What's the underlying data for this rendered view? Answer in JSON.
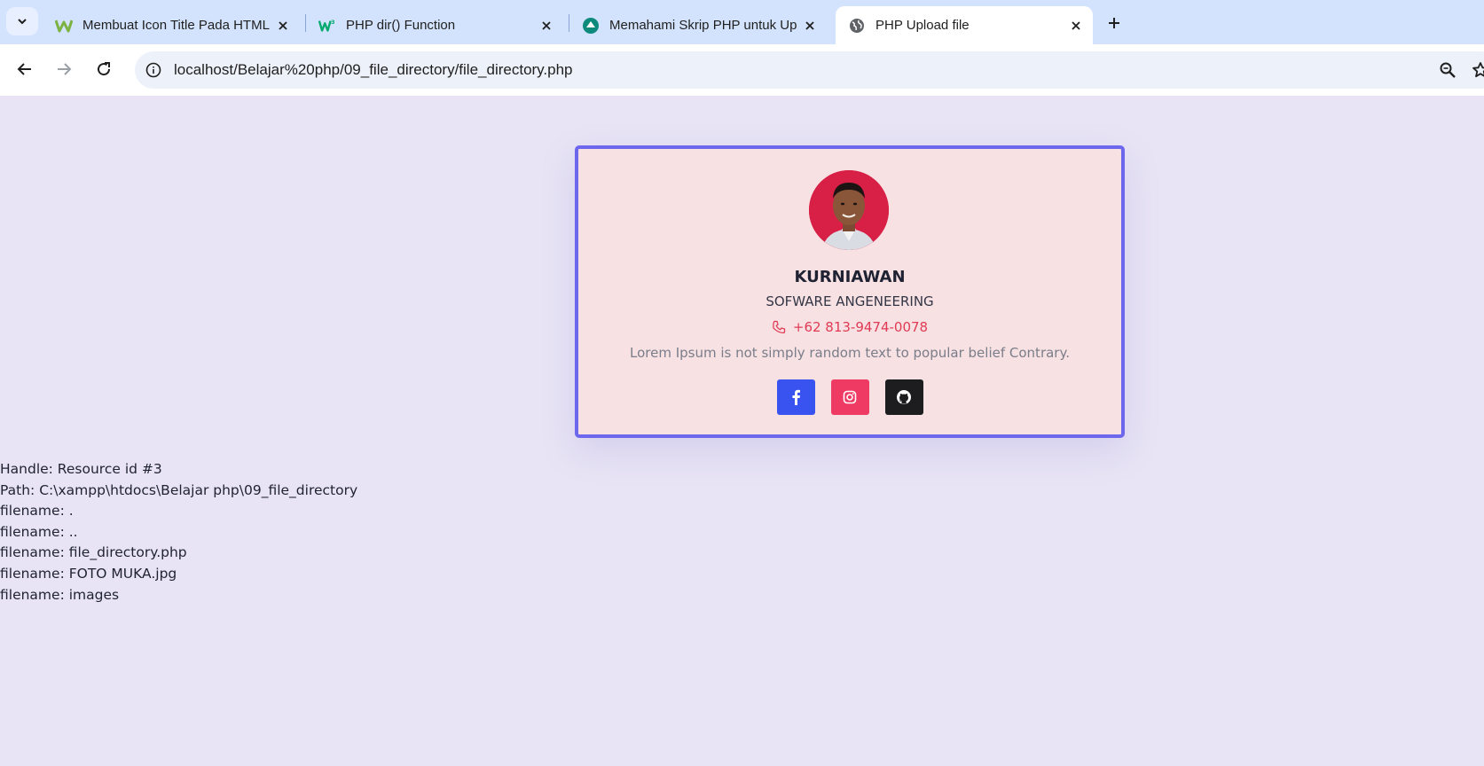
{
  "browser": {
    "tabs": [
      {
        "title": "Membuat Icon Title Pada HTML",
        "icon": "w-green-icon",
        "active": false
      },
      {
        "title": "PHP dir() Function",
        "icon": "w3schools-icon",
        "active": false
      },
      {
        "title": "Memahami Skrip PHP untuk Up",
        "icon": "teal-circle-icon",
        "active": false
      },
      {
        "title": "PHP Upload file",
        "icon": "globe-icon",
        "active": true
      }
    ],
    "url": "localhost/Belajar%20php/09_file_directory/file_directory.php"
  },
  "profile": {
    "name": "KURNIAWAN",
    "role": "SOFWARE ANGENEERING",
    "phone": "+62 813-9474-0078",
    "description": "Lorem Ipsum is not simply random text to popular belief Contrary."
  },
  "output": {
    "handle": "Handle: Resource id #3",
    "path": "Path: C:\\xampp\\htdocs\\Belajar php\\09_file_directory",
    "files": [
      "filename: .",
      "filename: ..",
      "filename: file_directory.php",
      "filename: FOTO MUKA.jpg",
      "filename: images"
    ]
  },
  "colors": {
    "accent_border": "#6d67ee",
    "phone": "#e03a54",
    "facebook": "#3953f0",
    "instagram": "#ef3b63",
    "github": "#1d1d1f"
  }
}
